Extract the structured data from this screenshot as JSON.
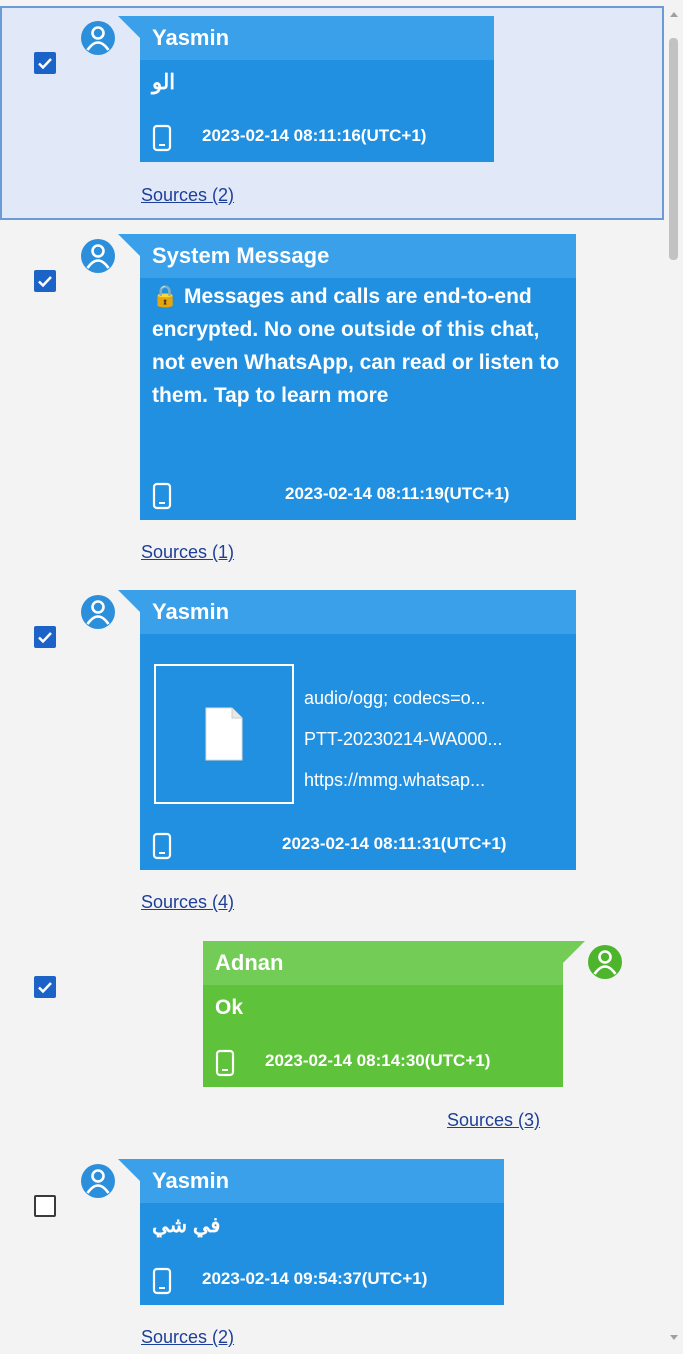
{
  "messages": [
    {
      "sender": "Yasmin",
      "text": "الو",
      "timestamp": "2023-02-14 08:11:16(UTC+1)",
      "sources": "Sources (2)",
      "checked": true,
      "selected": true,
      "direction": "incoming",
      "device_icon": "phone-icon"
    },
    {
      "sender": "System Message",
      "text": "🔒 Messages and calls are end-to-end encrypted. No one outside of this chat, not even WhatsApp, can read or listen to them. Tap to learn more",
      "timestamp": "2023-02-14 08:11:19(UTC+1)",
      "sources": "Sources (1)",
      "checked": true,
      "direction": "incoming"
    },
    {
      "sender": "Yasmin",
      "attachment": {
        "mime": "audio/ogg; codecs=o...",
        "filename": "PTT-20230214-WA000...",
        "url": "https://mmg.whatsap...",
        "icon": "file-icon"
      },
      "timestamp": "2023-02-14 08:11:31(UTC+1)",
      "sources": "Sources (4)",
      "checked": true,
      "direction": "incoming"
    },
    {
      "sender": "Adnan",
      "text": "Ok",
      "timestamp": "2023-02-14 08:14:30(UTC+1)",
      "sources": "Sources (3)",
      "checked": true,
      "direction": "outgoing"
    },
    {
      "sender": "Yasmin",
      "text": "في شي",
      "timestamp": "2023-02-14 09:54:37(UTC+1)",
      "sources": "Sources (2)",
      "checked": false,
      "direction": "incoming"
    }
  ],
  "colors": {
    "incoming_bubble": "#2290e0",
    "incoming_header": "#3aa0ea",
    "outgoing_bubble": "#5ec23a",
    "outgoing_header": "#72cc55",
    "checkbox": "#1b63c6",
    "link": "#1d3f99",
    "selection": "#e1e9f8"
  }
}
